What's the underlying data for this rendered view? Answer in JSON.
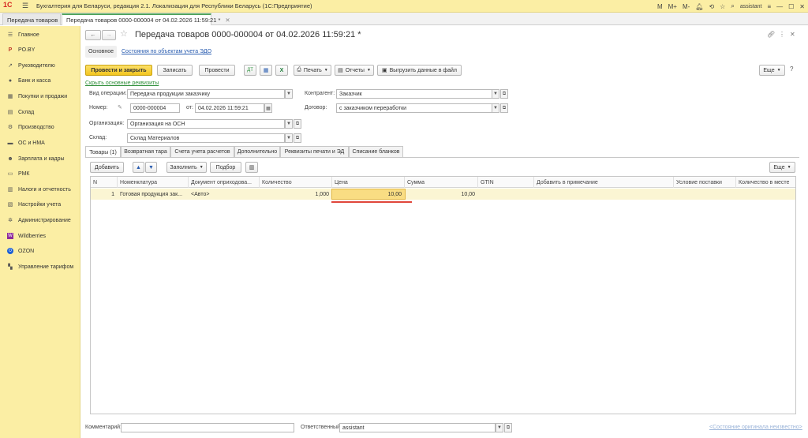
{
  "titlebar": {
    "logo": "1С",
    "title": "Бухгалтерия для Беларуси, редакция 2.1. Локализация для Республики Беларусь   (1С:Предприятие)",
    "right_labels": [
      "M",
      "M+",
      "M-"
    ],
    "user": "assistant"
  },
  "window_tabs": [
    {
      "label": "Передача товаров",
      "active": false
    },
    {
      "label": "Передача товаров 0000-000004 от 04.02.2026 11:59:21 *",
      "active": true
    }
  ],
  "sidebar": {
    "items": [
      {
        "label": "Главное",
        "icon": "menu-icon"
      },
      {
        "label": "PO.BY",
        "icon": "po-by-icon"
      },
      {
        "label": "Руководителю",
        "icon": "chart-icon"
      },
      {
        "label": "Банк и касса",
        "icon": "bank-icon"
      },
      {
        "label": "Покупки и продажи",
        "icon": "cart-icon"
      },
      {
        "label": "Склад",
        "icon": "warehouse-icon"
      },
      {
        "label": "Производство",
        "icon": "production-icon"
      },
      {
        "label": "ОС и НМА",
        "icon": "assets-icon"
      },
      {
        "label": "Зарплата и кадры",
        "icon": "salary-icon"
      },
      {
        "label": "РМК",
        "icon": "pos-icon"
      },
      {
        "label": "Налоги и отчетность",
        "icon": "taxes-icon"
      },
      {
        "label": "Настройки учета",
        "icon": "settings-icon"
      },
      {
        "label": "Администрирование",
        "icon": "gear-icon"
      },
      {
        "label": "Wildberries",
        "icon": "wildberries-icon"
      },
      {
        "label": "OZON",
        "icon": "ozon-icon"
      },
      {
        "label": "Управление тарифом",
        "icon": "tariff-icon"
      }
    ]
  },
  "doc": {
    "title": "Передача товаров 0000-000004 от 04.02.2026 11:59:21 *",
    "nav_main": "Основное",
    "nav_edo": "Состояния по объектам учета ЭДО",
    "toolbar": {
      "post_close": "Провести и закрыть",
      "save": "Записать",
      "post": "Провести",
      "print": "Печать",
      "reports": "Отчеты",
      "export": "Выгрузить данные в файл",
      "more": "Еще"
    },
    "hide_details": "Скрыть основные реквизиты",
    "fields": {
      "op_type_label": "Вид операции:",
      "op_type": "Передача продукции заказчику",
      "counterparty_label": "Контрагент:",
      "counterparty": "Заказчик",
      "number_label": "Номер:",
      "number": "0000-000004",
      "date_label": "от:",
      "date": "04.02.2026 11:59:21",
      "contract_label": "Договор:",
      "contract": "с заказчиком переработки",
      "org_label": "Организация:",
      "org": "Организация на ОСН",
      "warehouse_label": "Склад:",
      "warehouse": "Склад Материалов"
    },
    "tabs": [
      "Товары (1)",
      "Возвратная тара",
      "Счета учета расчетов",
      "Дополнительно",
      "Реквизиты печати и ЭД",
      "Списание бланков"
    ],
    "grid_toolbar": {
      "add": "Добавить",
      "fill": "Заполнить",
      "select": "Подбор",
      "more": "Еще"
    },
    "columns": [
      "N",
      "Номенклатура",
      "Документ оприходова...",
      "Количество",
      "Цена",
      "Сумма",
      "GTIN",
      "Добавить в примечание",
      "Условие поставки",
      "Количество в месте"
    ],
    "rows": [
      {
        "n": "1",
        "item": "Готовая продукция зак...",
        "doc": "<Авто>",
        "qty": "1,000",
        "price": "10,00",
        "sum": "10,00"
      }
    ],
    "footer": {
      "comment_label": "Комментарий:",
      "comment": "",
      "responsible_label": "Ответственный:",
      "responsible": "assistant",
      "state_link": "<Состояние оригинала неизвестно>"
    }
  }
}
